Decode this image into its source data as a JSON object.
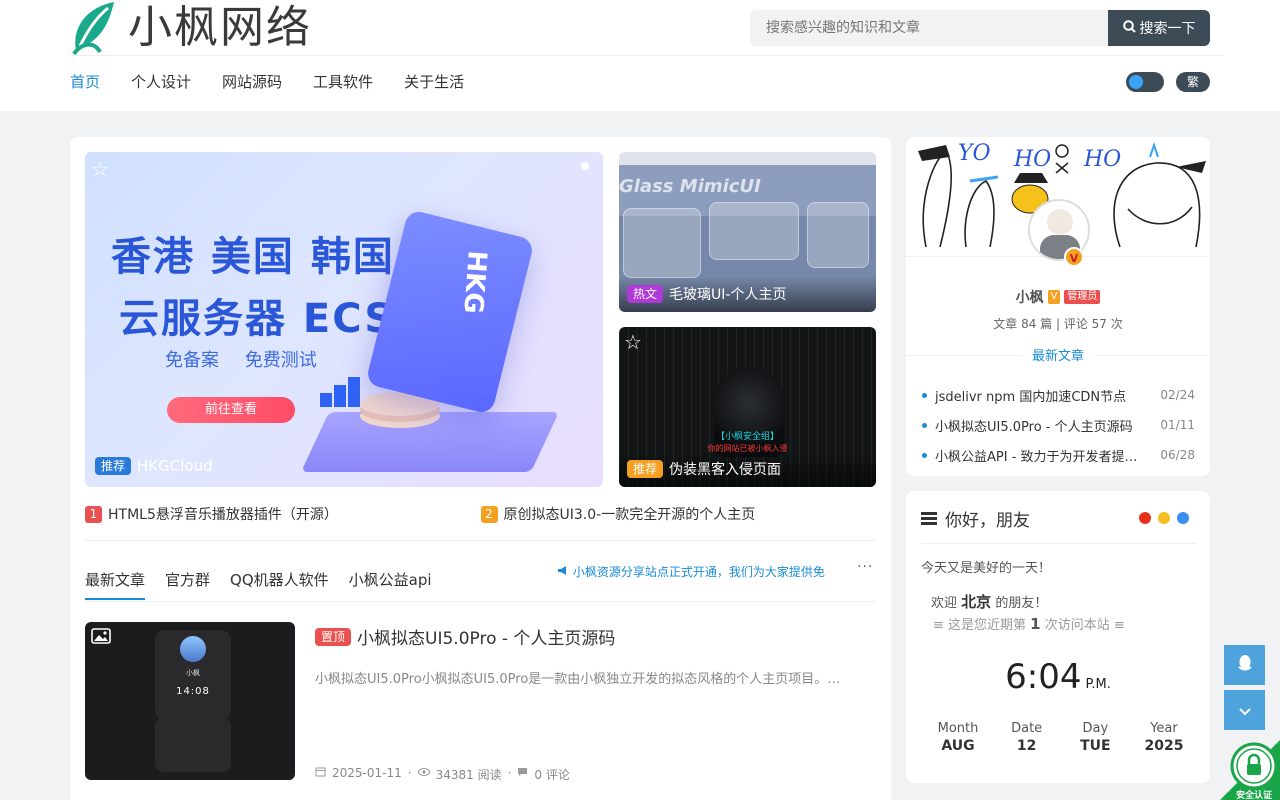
{
  "header": {
    "logo_text": "小枫网络",
    "search_placeholder": "搜索感兴趣的知识和文章",
    "search_button": "搜索一下",
    "nav": [
      {
        "label": "首页"
      },
      {
        "label": "个人设计"
      },
      {
        "label": "网站源码"
      },
      {
        "label": "工具软件"
      },
      {
        "label": "关于生活"
      }
    ],
    "lang_toggle": "繁"
  },
  "banner": {
    "line1": "香港 美国 韩国",
    "line2": "云服务器 ECS",
    "line3": "免备案 免费测试",
    "button": "前往查看",
    "card_text": "HKG",
    "tag": "推荐",
    "caption": "HKGCloud"
  },
  "side_cards": [
    {
      "tag": "热文",
      "title": "毛玻璃UI-个人主页",
      "art_title": "Glass MimicUI"
    },
    {
      "tag": "推荐",
      "title": "伪装黑客入侵页面",
      "art_line1": "【小枫安全组】",
      "art_line2": "你的网站已被小枫入侵"
    }
  ],
  "hot_list": [
    {
      "num": "1",
      "title": "HTML5悬浮音乐播放器插件（开源）",
      "color": "#e9504f"
    },
    {
      "num": "2",
      "title": "原创拟态UI3.0-一款完全开源的个人主页",
      "color": "#f6a021"
    }
  ],
  "tabs": [
    "最新文章",
    "官方群",
    "QQ机器人软件",
    "小枫公益api"
  ],
  "notice": "小枫资源分享站点正式开通，我们为大家提供免",
  "more": "···",
  "post": {
    "tag": "置顶",
    "title": "小枫拟态UI5.0Pro - 个人主页源码",
    "desc": "小枫拟态UI5.0Pro小枫拟态UI5.0Pro是一款由小枫独立开发的拟态风格的个人主页项目。…",
    "date": "2025-01-11",
    "views": "34381 阅读",
    "comments": "0 评论",
    "thumb_name": "小枫",
    "thumb_time": "14:08"
  },
  "profile": {
    "doodles": [
      "YO",
      "HO",
      "HO"
    ],
    "name": "小枫",
    "v_tag": "V",
    "role": "管理员",
    "stats": "文章 84 篇 | 评论 57 次",
    "latest_head": "最新文章",
    "latest": [
      {
        "title": "jsdelivr npm 国内加速CDN节点",
        "date": "02/24"
      },
      {
        "title": "小枫拟态UI5.0Pro - 个人主页源码",
        "date": "01/11"
      },
      {
        "title": "小枫公益API - 致力于为开发者提供稳定的API",
        "date": "06/28"
      }
    ]
  },
  "greeting": {
    "title": "你好，朋友",
    "dot_colors": [
      "#e8311b",
      "#f6c022",
      "#3b8ff0"
    ],
    "message": "今天又是美好的一天！",
    "welcome_prefix": "欢迎",
    "city": "北京",
    "welcome_suffix": "的朋友！",
    "visit_prefix": "≡ 这是您近期第",
    "visit_count": "1",
    "visit_suffix": "次访问本站 ≡",
    "time": "6:04",
    "ampm": "P.M.",
    "date": [
      {
        "label": "Month",
        "value": "AUG"
      },
      {
        "label": "Date",
        "value": "12"
      },
      {
        "label": "Day",
        "value": "TUE"
      },
      {
        "label": "Year",
        "value": "2025"
      }
    ]
  },
  "ssl_label": "安全认证",
  "colors": {
    "accent": "#1a8cd8",
    "dark": "#3d4b57"
  }
}
